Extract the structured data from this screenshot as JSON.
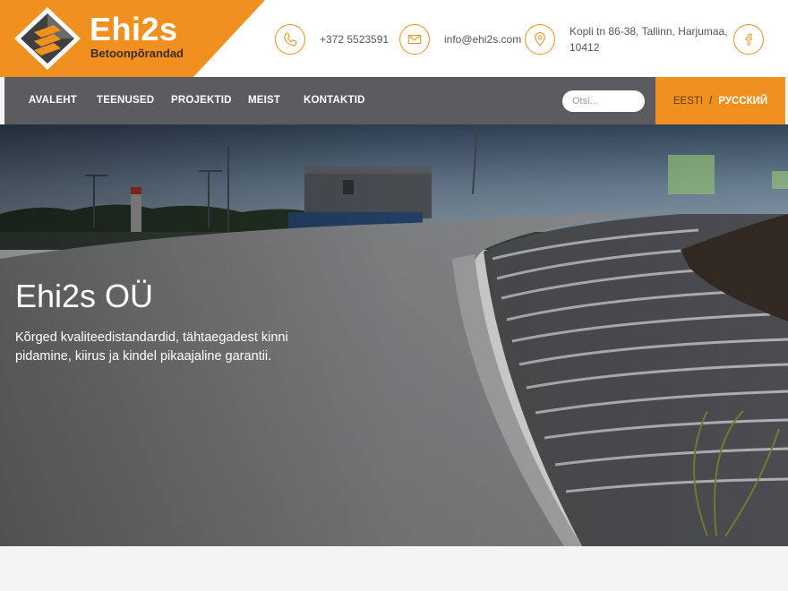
{
  "brand": {
    "name": "Ehi2s",
    "subtitle": "Betoonpõrandad",
    "accent_color": "#f0901e"
  },
  "contacts": {
    "phone": "+372 5523591",
    "email": "info@ehi2s.com",
    "address_line1": "Kopli tn 86-38, Tallinn, Harjumaa,",
    "address_line2": "10412"
  },
  "nav": {
    "items": [
      "AVALEHT",
      "TEENUSED",
      "PROJEKTID",
      "MEIST",
      "KONTAKTID"
    ],
    "search_placeholder": "Otsi..."
  },
  "language": {
    "active": "EESTI",
    "separator": "/",
    "other": "РУССКИЙ"
  },
  "hero": {
    "title": "Ehi2s OÜ",
    "text": "Kõrged kvaliteedistandardid, tähtaegadest kinni pidamine, kiirus ja kindel pikaajaline garantii."
  }
}
